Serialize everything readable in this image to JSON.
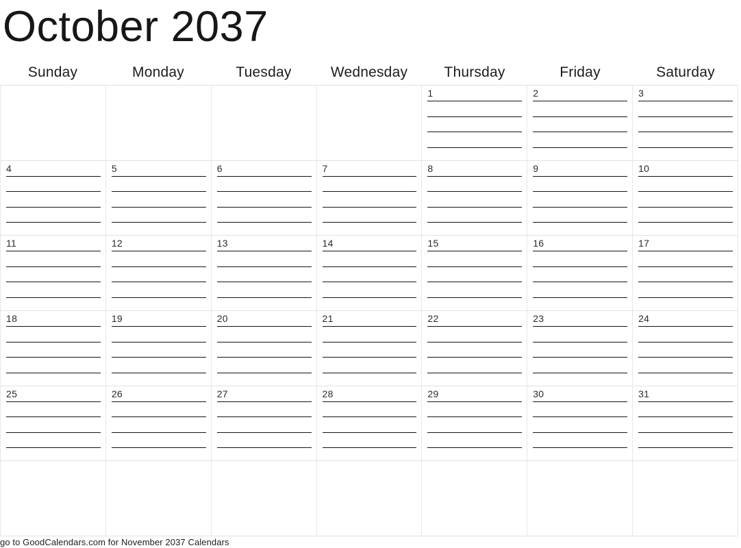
{
  "calendar": {
    "title": "October 2037",
    "month": "October",
    "year": "2037",
    "weekdays": [
      {
        "label": "Sunday"
      },
      {
        "label": "Monday"
      },
      {
        "label": "Tuesday"
      },
      {
        "label": "Wednesday"
      },
      {
        "label": "Thursday"
      },
      {
        "label": "Friday"
      },
      {
        "label": "Saturday"
      }
    ],
    "lines_per_day": 4,
    "weeks": [
      {
        "days": [
          {
            "num": ""
          },
          {
            "num": ""
          },
          {
            "num": ""
          },
          {
            "num": ""
          },
          {
            "num": "1"
          },
          {
            "num": "2"
          },
          {
            "num": "3"
          }
        ]
      },
      {
        "days": [
          {
            "num": "4"
          },
          {
            "num": "5"
          },
          {
            "num": "6"
          },
          {
            "num": "7"
          },
          {
            "num": "8"
          },
          {
            "num": "9"
          },
          {
            "num": "10"
          }
        ]
      },
      {
        "days": [
          {
            "num": "11"
          },
          {
            "num": "12"
          },
          {
            "num": "13"
          },
          {
            "num": "14"
          },
          {
            "num": "15"
          },
          {
            "num": "16"
          },
          {
            "num": "17"
          }
        ]
      },
      {
        "days": [
          {
            "num": "18"
          },
          {
            "num": "19"
          },
          {
            "num": "20"
          },
          {
            "num": "21"
          },
          {
            "num": "22"
          },
          {
            "num": "23"
          },
          {
            "num": "24"
          }
        ]
      },
      {
        "days": [
          {
            "num": "25"
          },
          {
            "num": "26"
          },
          {
            "num": "27"
          },
          {
            "num": "28"
          },
          {
            "num": "29"
          },
          {
            "num": "30"
          },
          {
            "num": "31"
          }
        ]
      },
      {
        "days": [
          {
            "num": ""
          },
          {
            "num": ""
          },
          {
            "num": ""
          },
          {
            "num": ""
          },
          {
            "num": ""
          },
          {
            "num": ""
          },
          {
            "num": ""
          }
        ]
      }
    ],
    "colors": {
      "text": "#171717",
      "grid_line": "#e4e4e4",
      "writing_line": "#141414",
      "background": "#ffffff"
    }
  },
  "footer": {
    "text": "go to GoodCalendars.com for November 2037 Calendars"
  }
}
